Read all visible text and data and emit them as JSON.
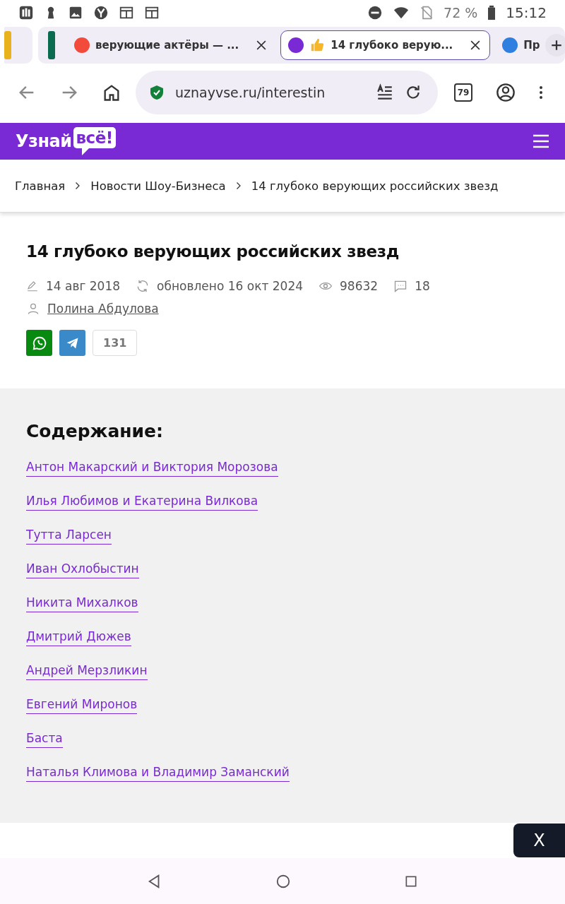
{
  "status_bar": {
    "battery": "72 %",
    "time": "15:12"
  },
  "tab_groups": [
    {
      "color": "#e8b21c"
    },
    {
      "color": "#0b6b4f"
    }
  ],
  "browser_tabs": [
    {
      "title": "верующие актёры — ...",
      "selected": false,
      "color": "#f24b3c"
    },
    {
      "title": "14 глубоко верую...",
      "selected": true,
      "color": "#7a2ad4"
    },
    {
      "title": "Пр",
      "selected": false,
      "color": "#2f7fe0"
    }
  ],
  "address_bar": {
    "url": "uznayvse.ru/interestin",
    "tab_count": "79"
  },
  "site_header": {
    "logo_word": "Узнай",
    "logo_bubble": "всё!"
  },
  "breadcrumbs": [
    "Главная",
    "Новости Шоу-Бизнеса",
    "14 глубоко верующих российских звезд"
  ],
  "article": {
    "title": "14 глубоко верующих российских звезд",
    "published": "14 авг 2018",
    "updated": "обновлено 16 окт 2024",
    "views": "98632",
    "comments": "18",
    "author": "Полина Абдулова",
    "share_count": "131"
  },
  "contents": {
    "heading": "Содержание:",
    "items": [
      "Антон Макарский и Виктория Морозова",
      "Илья Любимов и Екатерина Вилкова",
      "Тутта Ларсен",
      "Иван Охлобыстин",
      "Никита Михалков",
      "Дмитрий Дюжев",
      "Андрей Мерзликин",
      "Евгений Миронов",
      "Баста",
      "Наталья Климова и Владимир Заманский"
    ]
  },
  "ad_close": {
    "label": "X"
  }
}
